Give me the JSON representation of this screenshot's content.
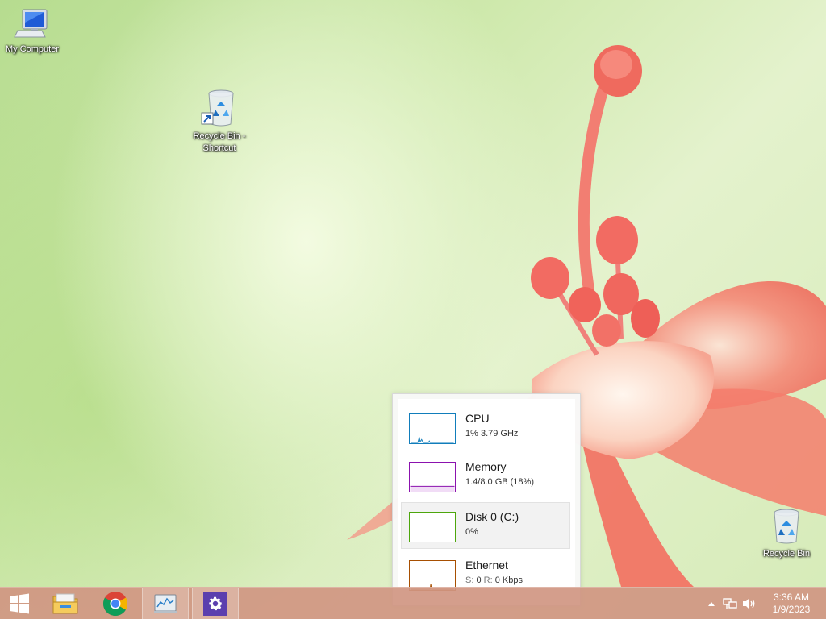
{
  "desktop": {
    "icons": [
      {
        "label": "My Computer",
        "icon": "computer-icon"
      },
      {
        "label": "Recycle Bin - Shortcut",
        "icon": "recycle-bin-shortcut-icon"
      },
      {
        "label": "Recycle Bin",
        "icon": "recycle-bin-icon"
      }
    ]
  },
  "performance": {
    "items": [
      {
        "name": "CPU",
        "value": "1%  3.79 GHz",
        "color": "#117dbb"
      },
      {
        "name": "Memory",
        "value": "1.4/8.0 GB (18%)",
        "color": "#8b12ae"
      },
      {
        "name": "Disk 0 (C:)",
        "value": "0%",
        "color": "#4da60c"
      },
      {
        "name": "Ethernet",
        "send_label": "S:",
        "send_value": "0",
        "recv_label": "R:",
        "recv_value": "0 Kbps",
        "color": "#a74f01"
      }
    ],
    "selected": "Disk 0 (C:)"
  },
  "taskbar": {
    "items": [
      {
        "name": "start-button",
        "icon": "windows-logo-icon"
      },
      {
        "name": "file-explorer",
        "icon": "folder-icon"
      },
      {
        "name": "chrome",
        "icon": "chrome-icon"
      },
      {
        "name": "task-manager",
        "icon": "task-manager-icon"
      },
      {
        "name": "settings",
        "icon": "gear-icon"
      }
    ],
    "tray": {
      "icons": [
        "show-hidden-icons-arrow",
        "network-icon",
        "volume-icon"
      ]
    },
    "clock": {
      "time": "3:36 AM",
      "date": "1/9/2023"
    }
  },
  "colors": {
    "taskbar": "#d09682",
    "settings_tile": "#5b3fae"
  }
}
